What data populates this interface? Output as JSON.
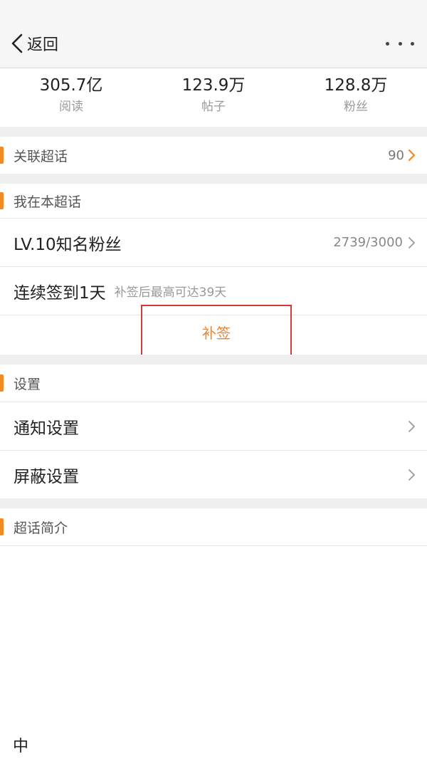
{
  "nav": {
    "back_label": "返回",
    "more_icon": "more-icon"
  },
  "stats": [
    {
      "value": "305.7亿",
      "label": "阅读"
    },
    {
      "value": "123.9万",
      "label": "帖子"
    },
    {
      "value": "128.8万",
      "label": "粉丝"
    }
  ],
  "related": {
    "title": "关联超话",
    "count": "90"
  },
  "my_section": {
    "title": "我在本超话",
    "level_label": "LV.10知名粉丝",
    "level_progress": "2739/3000",
    "checkin_label": "连续签到1天",
    "checkin_hint": "补签后最高可达39天",
    "makeup_button": "补签"
  },
  "settings": {
    "title": "设置",
    "notify_label": "通知设置",
    "block_label": "屏蔽设置"
  },
  "intro": {
    "title": "超话简介",
    "partial_text": "中"
  },
  "colors": {
    "accent": "#f08a24",
    "highlight_box": "#d53a3a",
    "makeup_text": "#e3873a"
  }
}
